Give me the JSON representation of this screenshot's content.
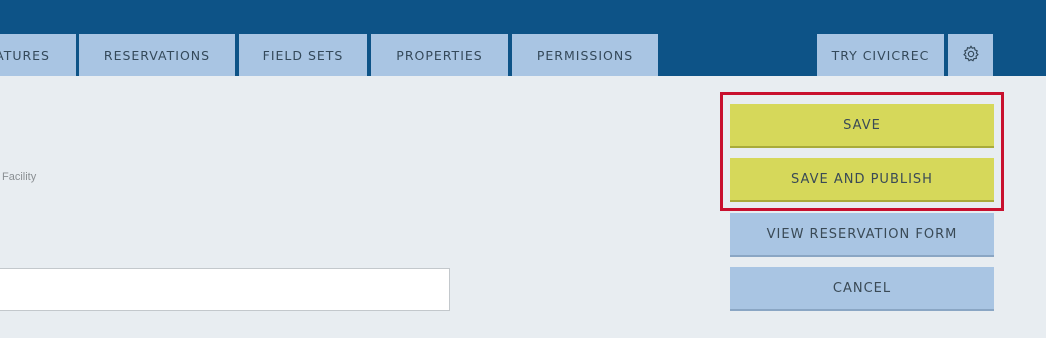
{
  "nav": {
    "tabs": [
      {
        "label": "ATURES"
      },
      {
        "label": "RESERVATIONS"
      },
      {
        "label": "FIELD SETS"
      },
      {
        "label": "PROPERTIES"
      },
      {
        "label": "PERMISSIONS"
      }
    ],
    "try_label": "TRY CIVICREC",
    "settings_icon": "gear-icon"
  },
  "form": {
    "facility_label": "Facility",
    "name_value": ""
  },
  "actions": {
    "save": "SAVE",
    "save_publish": "SAVE AND PUBLISH",
    "view_form": "VIEW RESERVATION FORM",
    "cancel": "CANCEL"
  },
  "colors": {
    "header": "#0d5387",
    "tab": "#a9c5e3",
    "primary_button": "#d6d85a",
    "highlight": "#c8102e",
    "page_bg": "#e8edf1"
  }
}
